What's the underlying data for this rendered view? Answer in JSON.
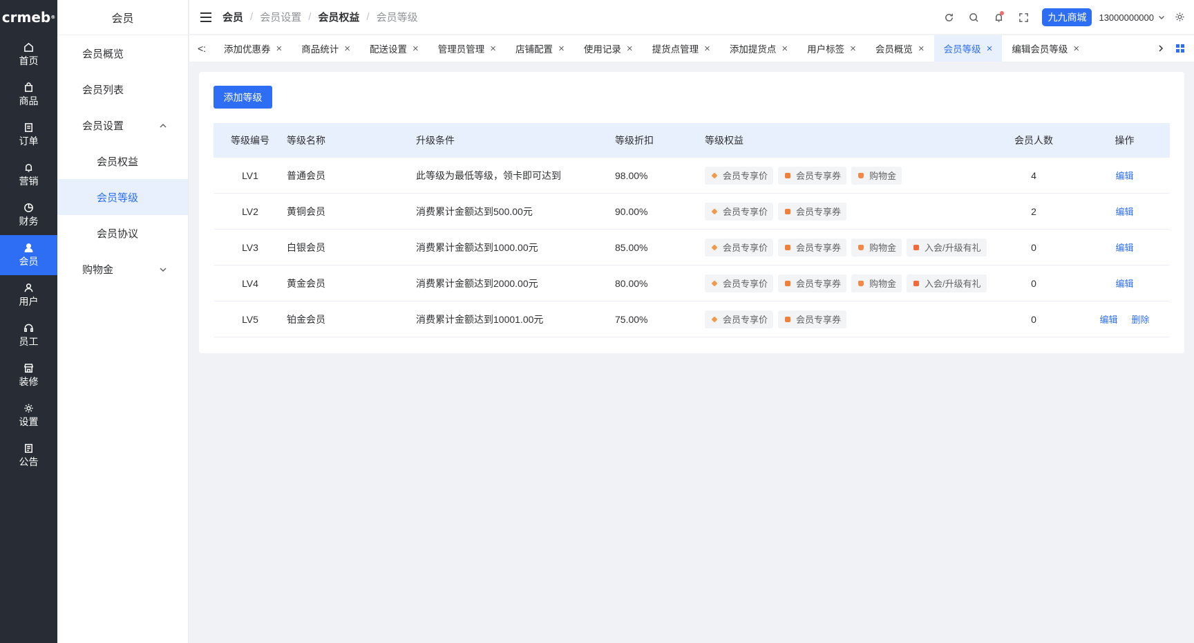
{
  "logo": "crmeb",
  "rail": [
    {
      "label": "首页",
      "icon": "home-icon"
    },
    {
      "label": "商品",
      "icon": "shopping-bag-icon"
    },
    {
      "label": "订单",
      "icon": "order-icon"
    },
    {
      "label": "营销",
      "icon": "bell-icon"
    },
    {
      "label": "财务",
      "icon": "pie-chart-icon"
    },
    {
      "label": "会员",
      "icon": "member-icon"
    },
    {
      "label": "用户",
      "icon": "user-icon"
    },
    {
      "label": "员工",
      "icon": "headset-icon"
    },
    {
      "label": "装修",
      "icon": "storefront-icon"
    },
    {
      "label": "设置",
      "icon": "gear-icon"
    },
    {
      "label": "公告",
      "icon": "notice-icon"
    }
  ],
  "submenu": {
    "title": "会员",
    "items": [
      {
        "label": "会员概览"
      },
      {
        "label": "会员列表"
      },
      {
        "label": "会员设置"
      },
      {
        "label": "会员权益"
      },
      {
        "label": "会员等级"
      },
      {
        "label": "会员协议"
      },
      {
        "label": "购物金"
      }
    ]
  },
  "breadcrumb": [
    "会员",
    "会员设置",
    "会员权益",
    "会员等级"
  ],
  "header": {
    "shop": "九九商城",
    "user": "13000000000",
    "notification_color": "#f56c6c"
  },
  "tabs": [
    {
      "label": "添加优惠券"
    },
    {
      "label": "商品统计"
    },
    {
      "label": "配送设置"
    },
    {
      "label": "管理员管理"
    },
    {
      "label": "店铺配置"
    },
    {
      "label": "使用记录"
    },
    {
      "label": "提货点管理"
    },
    {
      "label": "添加提货点"
    },
    {
      "label": "用户标签"
    },
    {
      "label": "会员概览"
    },
    {
      "label": "会员等级"
    },
    {
      "label": "编辑会员等级"
    }
  ],
  "main": {
    "add_button": "添加等级",
    "columns": [
      "等级编号",
      "等级名称",
      "升级条件",
      "等级折扣",
      "等级权益",
      "会员人数",
      "操作"
    ],
    "rows": [
      {
        "code": "LV1",
        "name": "普通会员",
        "condition": "此等级为最低等级，领卡即可达到",
        "discount": "98.00%",
        "perks": [
          "会员专享价",
          "会员专享券",
          "购物金"
        ],
        "count": "4",
        "actions": [
          "编辑"
        ]
      },
      {
        "code": "LV2",
        "name": "黄铜会员",
        "condition": "消费累计金额达到500.00元",
        "discount": "90.00%",
        "perks": [
          "会员专享价",
          "会员专享券"
        ],
        "count": "2",
        "actions": [
          "编辑"
        ]
      },
      {
        "code": "LV3",
        "name": "白银会员",
        "condition": "消费累计金额达到1000.00元",
        "discount": "85.00%",
        "perks": [
          "会员专享价",
          "会员专享券",
          "购物金",
          "入会/升级有礼"
        ],
        "count": "0",
        "actions": [
          "编辑"
        ]
      },
      {
        "code": "LV4",
        "name": "黄金会员",
        "condition": "消费累计金额达到2000.00元",
        "discount": "80.00%",
        "perks": [
          "会员专享价",
          "会员专享券",
          "购物金",
          "入会/升级有礼"
        ],
        "count": "0",
        "actions": [
          "编辑"
        ]
      },
      {
        "code": "LV5",
        "name": "铂金会员",
        "condition": "消费累计金额达到10001.00元",
        "discount": "75.00%",
        "perks": [
          "会员专享价",
          "会员专享券"
        ],
        "count": "0",
        "actions": [
          "编辑",
          "删除"
        ]
      }
    ]
  },
  "colors": {
    "primary": "#2d6ef5",
    "rail_bg": "#282c34",
    "table_header_bg": "#e8effd",
    "perk_icon": "#f5a051"
  }
}
